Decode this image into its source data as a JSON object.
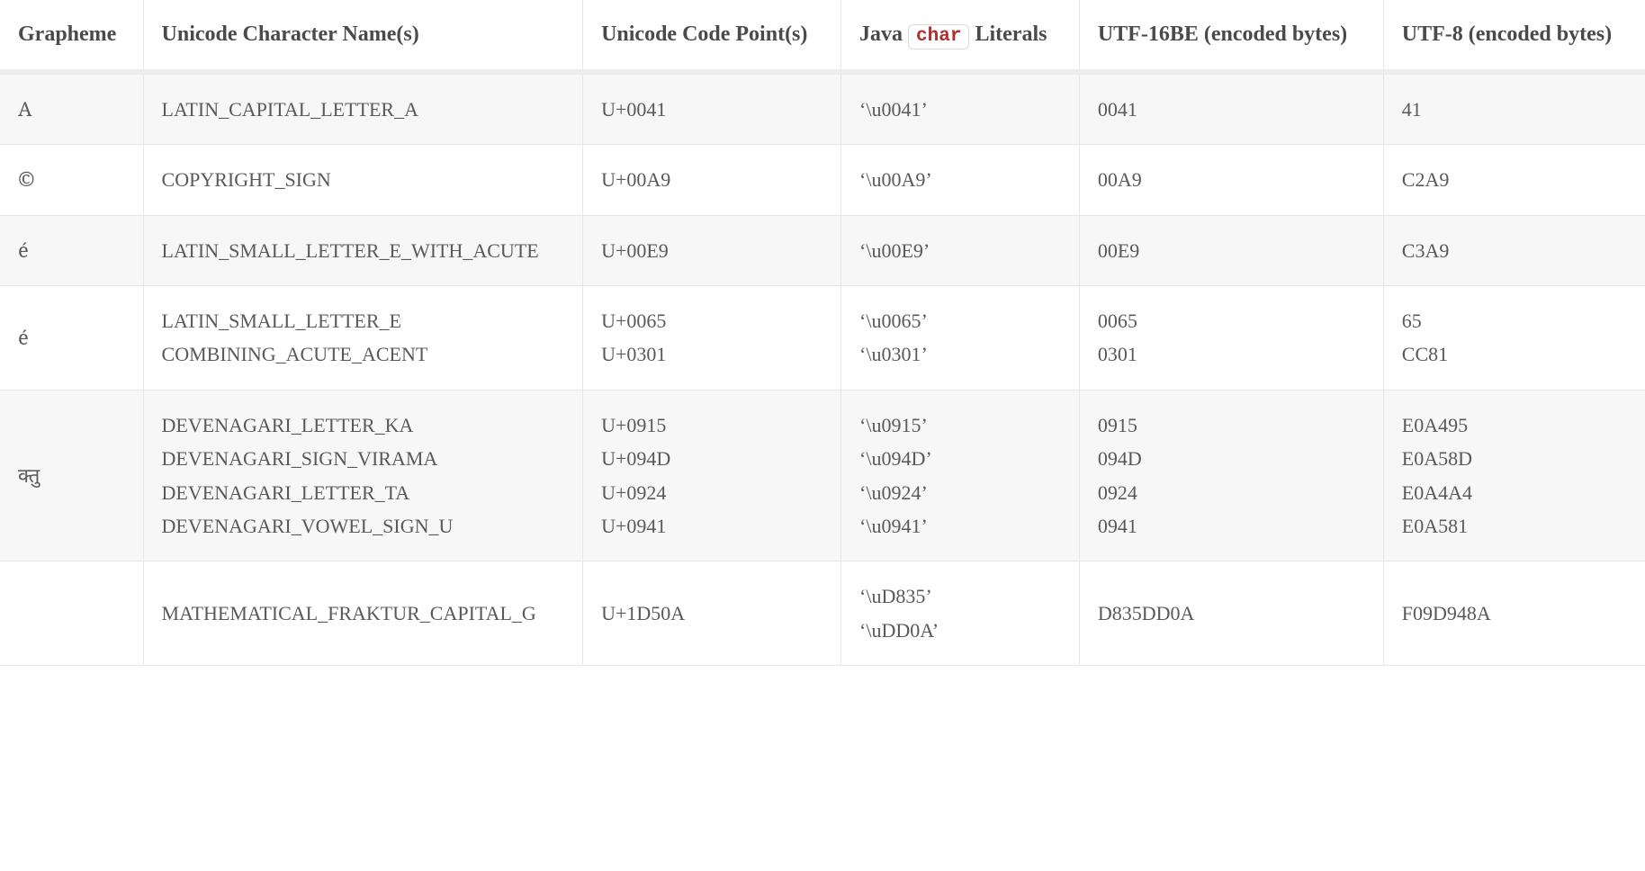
{
  "table": {
    "headers": {
      "grapheme": "Grapheme",
      "unicode_name": "Unicode Character Name(s)",
      "code_point": "Unicode Code Point(s)",
      "java_prefix": "Java ",
      "java_code": "char",
      "java_suffix": " Literals",
      "utf16be": "UTF-16BE (encoded bytes)",
      "utf8": "UTF-8 (encoded bytes)"
    },
    "rows": [
      {
        "grapheme": "A",
        "names": [
          "LATIN_CAPITAL_LETTER_A"
        ],
        "code_points": [
          "U+0041"
        ],
        "java_literals": [
          "‘\\u0041’"
        ],
        "utf16be": [
          "0041"
        ],
        "utf8": [
          "41"
        ]
      },
      {
        "grapheme": "©",
        "names": [
          "COPYRIGHT_SIGN"
        ],
        "code_points": [
          "U+00A9"
        ],
        "java_literals": [
          "‘\\u00A9’"
        ],
        "utf16be": [
          "00A9"
        ],
        "utf8": [
          "C2A9"
        ]
      },
      {
        "grapheme": "é",
        "names": [
          "LATIN_SMALL_LETTER_E_WITH_ACUTE"
        ],
        "code_points": [
          "U+00E9"
        ],
        "java_literals": [
          "‘\\u00E9’"
        ],
        "utf16be": [
          "00E9"
        ],
        "utf8": [
          "C3A9"
        ]
      },
      {
        "grapheme": "é",
        "names": [
          "LATIN_SMALL_LETTER_E",
          "COMBINING_ACUTE_ACENT"
        ],
        "code_points": [
          "U+0065",
          "U+0301"
        ],
        "java_literals": [
          "‘\\u0065’",
          "‘\\u0301’"
        ],
        "utf16be": [
          "0065",
          "0301"
        ],
        "utf8": [
          "65",
          "CC81"
        ]
      },
      {
        "grapheme": "क्तु",
        "names": [
          "DEVENAGARI_LETTER_KA",
          "DEVENAGARI_SIGN_VIRAMA",
          "DEVENAGARI_LETTER_TA",
          "DEVENAGARI_VOWEL_SIGN_U"
        ],
        "code_points": [
          "U+0915",
          "U+094D",
          "U+0924",
          "U+0941"
        ],
        "java_literals": [
          "‘\\u0915’",
          "‘\\u094D’",
          "‘\\u0924’",
          "‘\\u0941’"
        ],
        "utf16be": [
          "0915",
          "094D",
          "0924",
          "0941"
        ],
        "utf8": [
          "E0A495",
          "E0A58D",
          "E0A4A4",
          "E0A581"
        ]
      },
      {
        "grapheme": "",
        "names": [
          "MATHEMATICAL_FRAKTUR_CAPITAL_G"
        ],
        "code_points": [
          "U+1D50A"
        ],
        "java_literals": [
          "‘\\uD835’",
          "‘\\uDD0A’"
        ],
        "utf16be": [
          "D835DD0A"
        ],
        "utf8": [
          "F09D948A"
        ]
      }
    ]
  }
}
